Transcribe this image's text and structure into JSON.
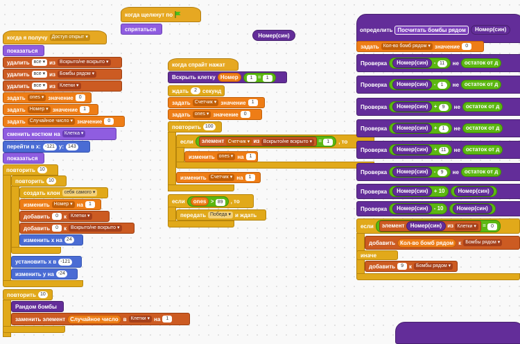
{
  "left": {
    "hat": {
      "when": "когда я получу",
      "msg": "Доступ открыт"
    },
    "show1": "показаться",
    "delete": "удалить",
    "all": "все",
    "from": "из",
    "list_hidden": "Вскрыто/не вскрыто",
    "list_bombs": "Бомбы рядом",
    "list_cells": "Клетки",
    "set": "задать",
    "value": "значение",
    "var_ones": "ones",
    "var_num": "Номер",
    "var_rand": "Случайное число",
    "val0": "0",
    "val1": "1",
    "switch_costume": "сменить костюм на",
    "costume": "Клетка",
    "goto": "перейти в x:",
    "x_val": "-121",
    "y_label": "y:",
    "y_val": "143",
    "show2": "показаться",
    "repeat": "повторить",
    "ten": "10",
    "create_clone": "создать клон",
    "self": "себя самого",
    "change": "изменить",
    "by": "на",
    "add": "добавить",
    "to": "к",
    "change_x": "изменить x на",
    "x_step": "24",
    "set_x": "установить x в",
    "change_y": "изменить y на",
    "y_step": "-24",
    "rand_bombs": "Рандом бомбы",
    "replace": "заменить элемент",
    "in": "в"
  },
  "top": {
    "flag_hat": "когда щелкнут по",
    "hide": "спрятаться",
    "reporter": "Номер(син)"
  },
  "mid": {
    "hat": "когда спрайт нажат",
    "open_cell": "Вскрыть клетку",
    "num": "Номер",
    "wait": "ждать",
    "wait_val": "2",
    "seconds": "секунд",
    "var_counter": "Счетчик",
    "set_counter_val": "1",
    "repeat_val": "100",
    "if": "если",
    "element": "элемент",
    "then": ", то",
    "change_ones_by": "1",
    "change_counter_by": "1",
    "gt_val": "89",
    "broadcast": "передать",
    "win": "Победа",
    "and_wait": "и ждать"
  },
  "right": {
    "define": "определить",
    "define_name": "Посчитать бомбы рядом",
    "param": "Номер(син)",
    "var_count": "Кол-во бомб рядом",
    "zero": "0",
    "check": "Проверка",
    "not": "не",
    "mod": "остаток от д",
    "rows": [
      {
        "op": "-",
        "n": "11"
      },
      {
        "op": "-",
        "n": "1"
      },
      {
        "op": "+",
        "n": "9"
      },
      {
        "op": "+",
        "n": "1"
      },
      {
        "op": "+",
        "n": "11"
      },
      {
        "op": "-",
        "n": "9"
      }
    ],
    "cmp1": "+ 10",
    "cmp2": "- 10",
    "cmp_num": "Номер(син)",
    "if_el": "элемент",
    "cells": "Клетки",
    "eq_val": "0",
    "add": "добавить",
    "var_count2": "Кол-во бомб рядом",
    "to": "к",
    "bombs_list": "Бомбы рядом",
    "else": "иначе",
    "nine": "9"
  }
}
